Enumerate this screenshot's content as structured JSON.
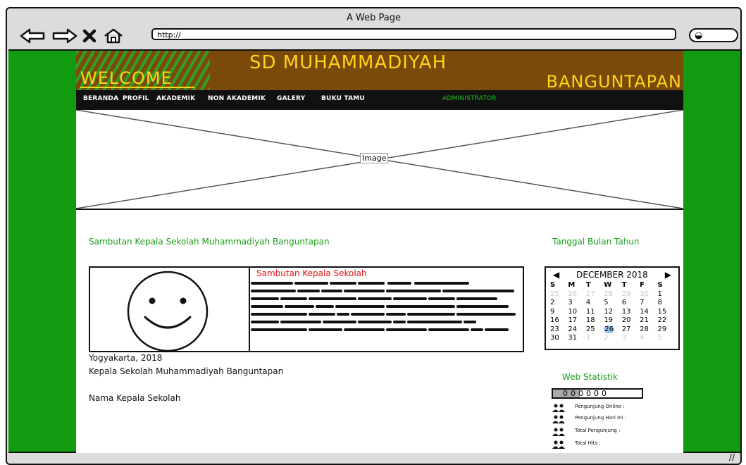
{
  "browser": {
    "page_title": "A Web Page",
    "url": "http://",
    "icons": [
      "back-arrow-icon",
      "forward-arrow-icon",
      "close-icon",
      "home-icon",
      "search-icon"
    ]
  },
  "header": {
    "welcome": "WELCOME",
    "school_line1": "SD MUHAMMADIYAH",
    "school_line2": "BANGUNTAPAN"
  },
  "menu": {
    "items": [
      "BERANDA",
      "PROFIL",
      "AKADEMIK",
      "NON AKADEMIK",
      "GALERY",
      "BUKU TAMU"
    ],
    "admin": "ADMINISTRATOR"
  },
  "hero": {
    "label": "Image"
  },
  "main": {
    "heading": "Sambutan Kepala Sekolah Muhammadiyah Banguntapan",
    "card_title": "Sambutan Kepala Sekolah",
    "place_date": "Yogyakarta, 2018",
    "principal_role": "Kepala Sekolah Muhammadiyah Banguntapan",
    "principal_name": "Nama Kepala Sekolah"
  },
  "sidebar": {
    "date_heading": "Tanggal Bulan Tahun",
    "calendar": {
      "month_label": "DECEMBER 2018",
      "weekdays": [
        "S",
        "M",
        "T",
        "W",
        "T",
        "F",
        "S"
      ],
      "weeks": [
        [
          "25",
          "26",
          "27",
          "28",
          "29",
          "30",
          "1"
        ],
        [
          "2",
          "3",
          "4",
          "5",
          "6",
          "7",
          "8"
        ],
        [
          "9",
          "10",
          "11",
          "12",
          "13",
          "14",
          "15"
        ],
        [
          "16",
          "17",
          "18",
          "19",
          "20",
          "21",
          "22"
        ],
        [
          "23",
          "24",
          "25",
          "26",
          "27",
          "28",
          "29"
        ],
        [
          "30",
          "31",
          "1",
          "2",
          "3",
          "4",
          "5"
        ]
      ],
      "selected_day": "26"
    },
    "stats_heading": "Web Statistik",
    "counter": "000000",
    "stats": [
      "Pengunjung Online :",
      "Pengunjung Hari Ini :",
      "Total Pengunjung :",
      "Total Hits :"
    ]
  },
  "colors": {
    "page_background": "#119b11",
    "banner": "#7a4a0a",
    "banner_text": "#ffd21a",
    "heading_green": "#1aa01a",
    "card_title_red": "#d11111",
    "calendar_highlight": "#9fc2ee"
  }
}
